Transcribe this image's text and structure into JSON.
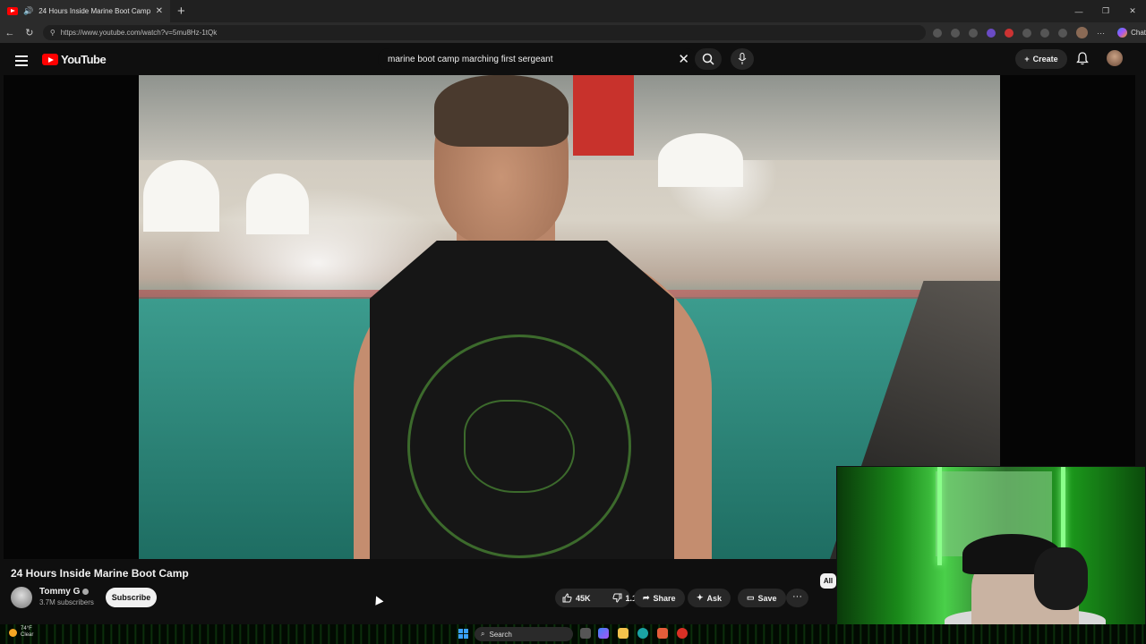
{
  "browser": {
    "tab_title": "24 Hours Inside Marine Boot Camp",
    "url": "https://www.youtube.com/watch?v=5mu8Hz-1tQk",
    "chat_label": "Chat"
  },
  "youtube": {
    "logo_text": "YouTube",
    "search_query": "marine boot camp marching first sergeant",
    "create_label": "Create"
  },
  "video": {
    "title": "24 Hours Inside Marine Boot Camp",
    "channel_name": "Tommy G",
    "subscribers": "3.7M subscribers",
    "subscribe_label": "Subscribe",
    "likes": "45K",
    "dislikes": "1.1K",
    "share_label": "Share",
    "ask_label": "Ask",
    "save_label": "Save",
    "more_label": "···",
    "chip_all": "All"
  },
  "taskbar": {
    "search_label": "Search",
    "weather_temp": "74°F",
    "weather_desc": "Clear"
  },
  "colors": {
    "accent": "#ff0000",
    "bg": "#0f0f0f"
  },
  "icons": [
    "menu-icon",
    "search-icon",
    "mic-icon",
    "bell-icon",
    "like-icon",
    "dislike-icon",
    "share-icon",
    "sparkle-icon",
    "save-icon"
  ]
}
